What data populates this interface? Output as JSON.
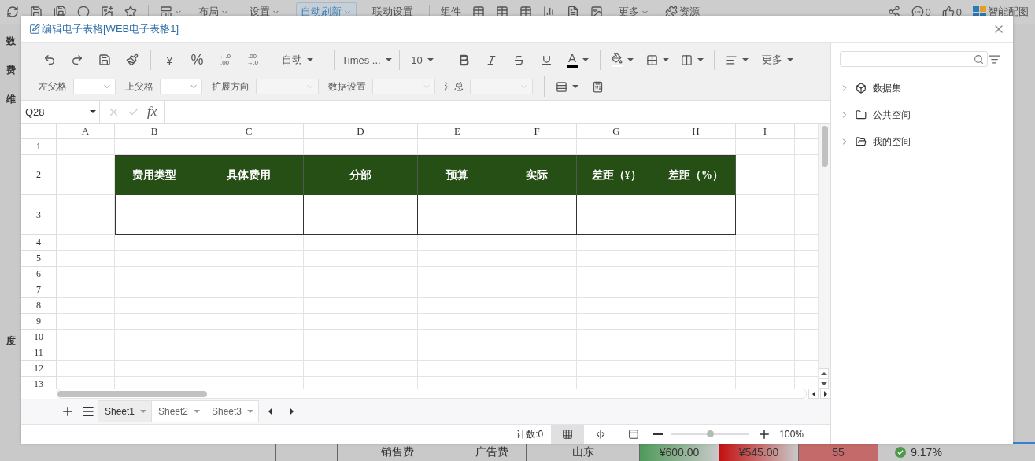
{
  "app_toolbar": {
    "menus": [
      {
        "label": "布局",
        "selected": false
      },
      {
        "label": "设置",
        "selected": false
      },
      {
        "label": "自动刷新",
        "selected": true
      },
      {
        "label": "联动设置",
        "selected": false
      }
    ],
    "components_label": "组件",
    "more_label": "更多",
    "resources_label": "资源",
    "comments": "0",
    "likes": "0",
    "smart_chart": "智能配图"
  },
  "background": {
    "side_labels": [
      "数",
      "费",
      "维",
      "度"
    ],
    "table_row": [
      {
        "text": "销售费",
        "kind": "plain"
      },
      {
        "text": "广告费",
        "kind": "plain"
      },
      {
        "text": "山东",
        "kind": "plain"
      },
      {
        "text": "¥600.00",
        "kind": "good"
      },
      {
        "text": "¥545.00",
        "kind": "bad"
      },
      {
        "text": "55",
        "kind": "alert"
      },
      {
        "text": "9.17%",
        "kind": "check"
      }
    ]
  },
  "dialog": {
    "title": "编辑电子表格[WEB电子表格1]",
    "toolbar": {
      "currency": "¥",
      "percent": "%",
      "decimal_buttons": [
        {
          "top": "←.0",
          "bottom": ".00"
        },
        {
          "top": ".00",
          "bottom": "→.0"
        }
      ],
      "number_format": "自动",
      "font_family": "Times ...",
      "font_size": "10",
      "font_color_label": "A",
      "more": "更多",
      "fields": [
        {
          "label": "左父格",
          "disabled": false
        },
        {
          "label": "上父格",
          "disabled": false
        },
        {
          "label": "扩展方向",
          "disabled": true
        },
        {
          "label": "数据设置",
          "disabled": true
        },
        {
          "label": "汇总",
          "disabled": true
        }
      ]
    },
    "formula_bar": {
      "cell_ref": "Q28",
      "function_label": "fx"
    },
    "sheet": {
      "columns": [
        "A",
        "B",
        "C",
        "D",
        "E",
        "F",
        "G",
        "H",
        "I"
      ],
      "header_cells": [
        "费用类型",
        "具体费用",
        "分部",
        "预算",
        "实际",
        "差距（¥）",
        "差距（%）"
      ],
      "rows": [
        {
          "label": "1",
          "kind": "plain"
        },
        {
          "label": "2",
          "kind": "header"
        },
        {
          "label": "3",
          "kind": "body"
        },
        {
          "label": "4",
          "kind": "plain"
        },
        {
          "label": "5",
          "kind": "plain"
        },
        {
          "label": "6",
          "kind": "plain"
        },
        {
          "label": "7",
          "kind": "plain"
        },
        {
          "label": "8",
          "kind": "plain"
        },
        {
          "label": "9",
          "kind": "plain"
        },
        {
          "label": "10",
          "kind": "plain"
        },
        {
          "label": "11",
          "kind": "plain"
        },
        {
          "label": "12",
          "kind": "plain"
        },
        {
          "label": "13",
          "kind": "plain"
        }
      ]
    },
    "sheet_tabs": [
      {
        "label": "Sheet1",
        "selected": true
      },
      {
        "label": "Sheet2",
        "selected": false
      },
      {
        "label": "Sheet3",
        "selected": false
      }
    ],
    "status_bar": {
      "count": "计数:0",
      "view_modes": [
        {
          "kind": "normal",
          "selected": true
        },
        {
          "kind": "page-break",
          "selected": false
        },
        {
          "kind": "page-layout",
          "selected": false
        }
      ],
      "zoom": {
        "level": 0.5,
        "reading": "100%"
      }
    },
    "side_panel": {
      "tree": [
        {
          "label": "数据集",
          "kind": "dataset",
          "expanded": false
        },
        {
          "label": "公共空间",
          "kind": "folder",
          "expanded": false
        },
        {
          "label": "我的空间",
          "kind": "personal",
          "expanded": false
        }
      ]
    }
  }
}
